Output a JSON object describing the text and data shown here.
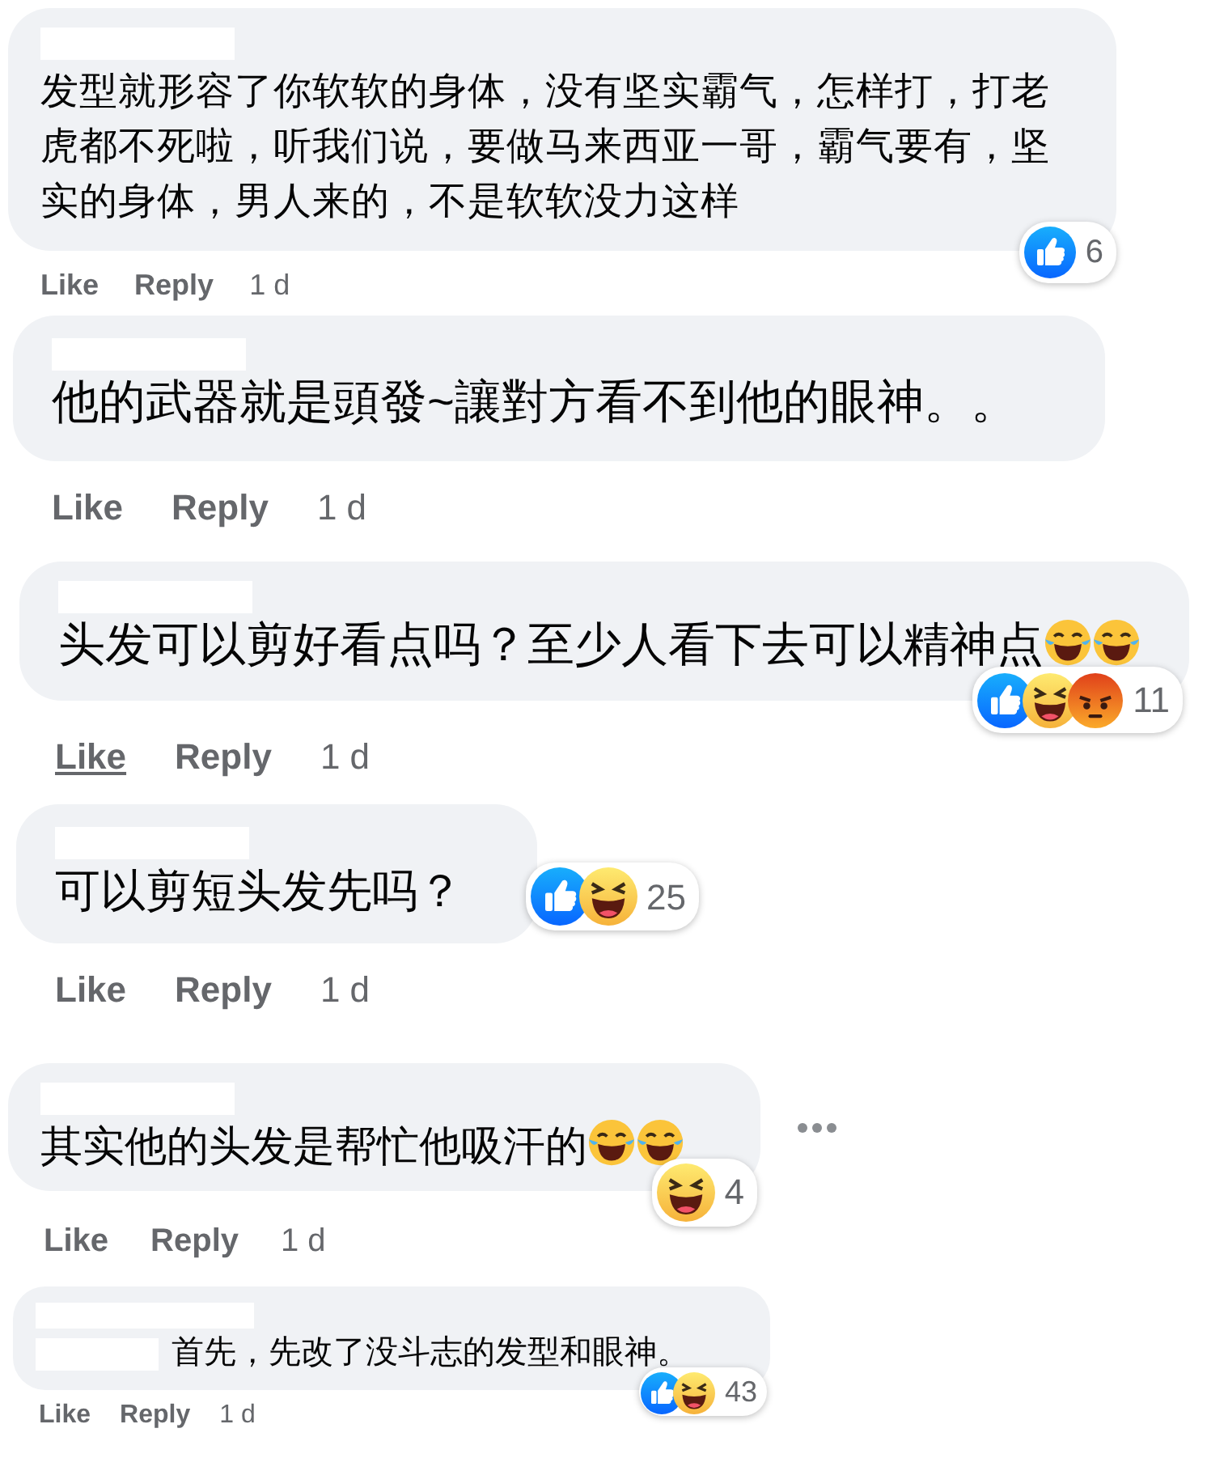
{
  "comments": [
    {
      "text": "发型就形容了你软软的身体，没有坚实霸气，怎样打，打老虎都不死啦，听我们说，要做马来西亚一哥，霸气要有，坚实的身体，男人来的，不是软软没力这样",
      "reactions": [
        {
          "kind": "like"
        }
      ],
      "count": "6",
      "actions": {
        "like": "Like",
        "reply": "Reply",
        "time": "1 d",
        "like_hovered": false
      }
    },
    {
      "text": "他的武器就是頭發~讓對方看不到他的眼神。。",
      "actions": {
        "like": "Like",
        "reply": "Reply",
        "time": "1 d",
        "like_hovered": false
      }
    },
    {
      "text": "头发可以剪好看点吗？至少人看下去可以精神点",
      "emoji": [
        {
          "kind": "laugh-cry"
        },
        {
          "kind": "laugh-cry"
        }
      ],
      "reactions": [
        {
          "kind": "like"
        },
        {
          "kind": "haha"
        },
        {
          "kind": "angry"
        }
      ],
      "count": "11",
      "actions": {
        "like": "Like",
        "reply": "Reply",
        "time": "1 d",
        "like_hovered": true
      }
    },
    {
      "text": "可以剪短头发先吗？",
      "reactions": [
        {
          "kind": "like"
        },
        {
          "kind": "haha"
        }
      ],
      "count": "25",
      "actions": {
        "like": "Like",
        "reply": "Reply",
        "time": "1 d",
        "like_hovered": false
      }
    },
    {
      "text": "其实他的头发是帮忙他吸汗的",
      "emoji": [
        {
          "kind": "laugh-cry"
        },
        {
          "kind": "laugh-cry"
        }
      ],
      "reactions": [
        {
          "kind": "haha"
        }
      ],
      "count": "4",
      "actions": {
        "like": "Like",
        "reply": "Reply",
        "time": "1 d",
        "like_hovered": false
      },
      "more": true
    },
    {
      "text": "首先，先改了没斗志的发型和眼神。",
      "reactions": [
        {
          "kind": "like"
        },
        {
          "kind": "haha"
        }
      ],
      "count": "43",
      "actions": {
        "like": "Like",
        "reply": "Reply",
        "time": "1 d",
        "like_hovered": false
      },
      "mention": true
    }
  ]
}
